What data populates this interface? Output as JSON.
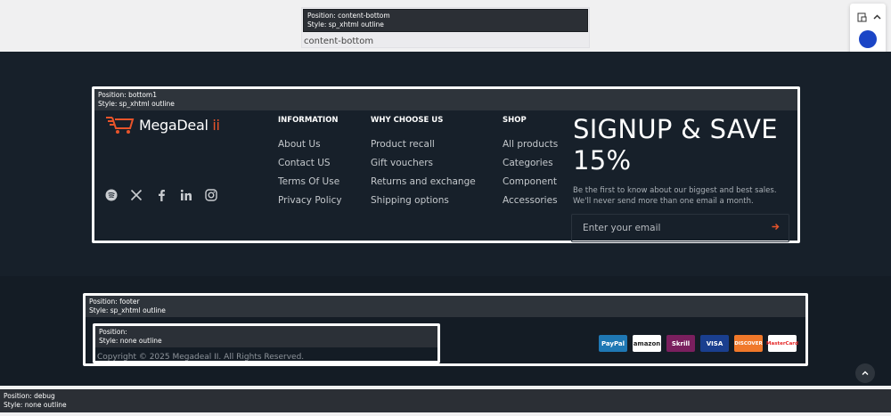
{
  "content_bottom": {
    "position": "Position: content-bottom",
    "style": "Style: sp_xhtml outline",
    "text": "content-bottom"
  },
  "side_panel": {
    "colors": [
      "#1b45c6",
      "#e8461a",
      "#16a59a",
      "#5246b2"
    ],
    "icons": [
      "layout-icon",
      "chevron-up-icon"
    ]
  },
  "bottom1": {
    "position": "Position: bottom1",
    "style": "Style: sp_xhtml outline",
    "logo_text": "MegaDeal",
    "logo_suffix": " ii",
    "socials": [
      "spotify-icon",
      "x-icon",
      "facebook-icon",
      "linkedin-icon",
      "instagram-icon"
    ],
    "columns": [
      {
        "title": "INFORMATION",
        "links": [
          "About Us",
          "Contact US",
          "Terms Of Use",
          "Privacy Policy"
        ]
      },
      {
        "title": "WHY CHOOSE US",
        "links": [
          "Product recall",
          "Gift vouchers",
          "Returns and exchange",
          "Shipping options"
        ]
      },
      {
        "title": "SHOP",
        "links": [
          "All products",
          "Categories",
          "Component",
          "Accessories"
        ]
      }
    ],
    "signup_title": "SIGNUP & SAVE 15%",
    "signup_text": "Be the first to know about our biggest and best sales. We'll never send more than one email a month.",
    "email_placeholder": "Enter your email",
    "accent": "#e8542a"
  },
  "footer": {
    "position": "Position: footer",
    "style": "Style: sp_xhtml outline",
    "inner_position": "Position:",
    "inner_style": "Style: none outline",
    "copyright": "Copyright © 2025 Megadeal II. All Rights Reserved.",
    "payments": [
      {
        "name": "PayPal",
        "bg": "#1f78b4",
        "fg": "#ffffff"
      },
      {
        "name": "amazon",
        "bg": "#ffffff",
        "fg": "#222222"
      },
      {
        "name": "Skrill",
        "bg": "#7a1f5e",
        "fg": "#ffffff"
      },
      {
        "name": "VISA",
        "bg": "#1a3f8f",
        "fg": "#ffffff"
      },
      {
        "name": "DISCOVER",
        "bg": "#f0782a",
        "fg": "#ffffff"
      },
      {
        "name": "MasterCard",
        "bg": "#ffffff",
        "fg": "#e52a2a"
      }
    ]
  },
  "debug": {
    "position": "Position: debug",
    "style": "Style: none outline"
  }
}
